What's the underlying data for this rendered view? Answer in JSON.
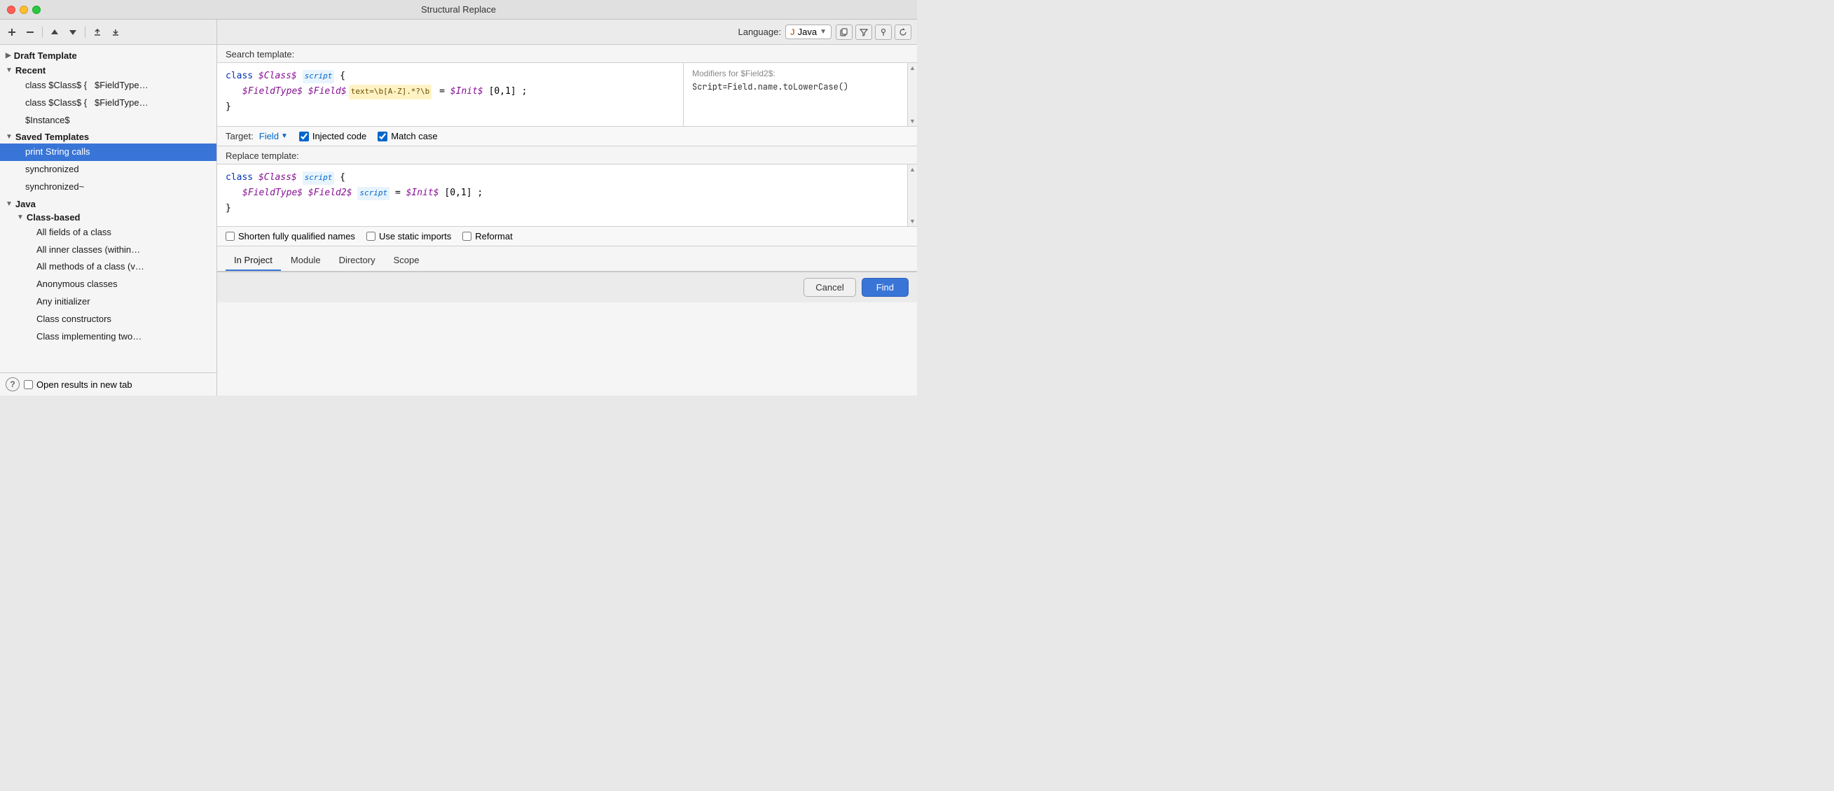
{
  "window": {
    "title": "Structural Replace"
  },
  "toolbar": {
    "add_template": "＋",
    "remove_template": "−",
    "move_up": "↑",
    "move_down": "↓",
    "export": "↗",
    "import": "↙"
  },
  "sidebar": {
    "draft_label": "Draft Template",
    "recent_label": "Recent",
    "recent_items": [
      "class $Class$ {   $FieldType…",
      "class $Class$ {   $FieldType…",
      "$Instance$"
    ],
    "saved_templates_label": "Saved Templates",
    "saved_items": [
      "print String calls",
      "synchronized",
      "synchronized~"
    ],
    "java_label": "Java",
    "class_based_label": "Class-based",
    "class_based_items": [
      "All fields of a class",
      "All inner classes (within…",
      "All methods of a class (v…",
      "Anonymous classes",
      "Any initializer",
      "Class constructors",
      "Class implementing two…"
    ]
  },
  "bottom": {
    "open_results_label": "Open results in new tab"
  },
  "header": {
    "language_label": "Language:",
    "language_value": "Java"
  },
  "search": {
    "section_label": "Search template:",
    "line1_kw": "class",
    "line1_var": "$Class$",
    "line1_badge": "script",
    "line1_brace": "{",
    "line2_type": "$FieldType$",
    "line2_field": "$Field$",
    "line2_regex": "text=\\b[A-Z].*?\\b",
    "line2_eq": "=",
    "line2_init": "$Init$",
    "line2_range": "[0,1]",
    "line2_semi": ";",
    "line3_brace": "}"
  },
  "modifiers": {
    "title": "Modifiers for $Field2$:",
    "value": "Script=Field.name.toLowerCase()"
  },
  "options": {
    "target_label": "Target:",
    "target_value": "Field",
    "injected_code_label": "Injected code",
    "match_case_label": "Match case",
    "injected_checked": true,
    "match_case_checked": true
  },
  "replace": {
    "section_label": "Replace template:",
    "line1_kw": "class",
    "line1_var": "$Class$",
    "line1_badge": "script",
    "line1_brace": "{",
    "line2_type": "$FieldType$",
    "line2_field": "$Field2$",
    "line2_badge": "script",
    "line2_eq": "=",
    "line2_init": "$Init$",
    "line2_range": "[0,1]",
    "line2_semi": ";",
    "line3_brace": "}",
    "shorten_label": "Shorten fully qualified names",
    "static_imports_label": "Use static imports",
    "reformat_label": "Reformat"
  },
  "scope_tabs": [
    {
      "label": "In Project",
      "active": true
    },
    {
      "label": "Module",
      "active": false
    },
    {
      "label": "Directory",
      "active": false
    },
    {
      "label": "Scope",
      "active": false
    }
  ],
  "actions": {
    "cancel_label": "Cancel",
    "find_label": "Find"
  }
}
